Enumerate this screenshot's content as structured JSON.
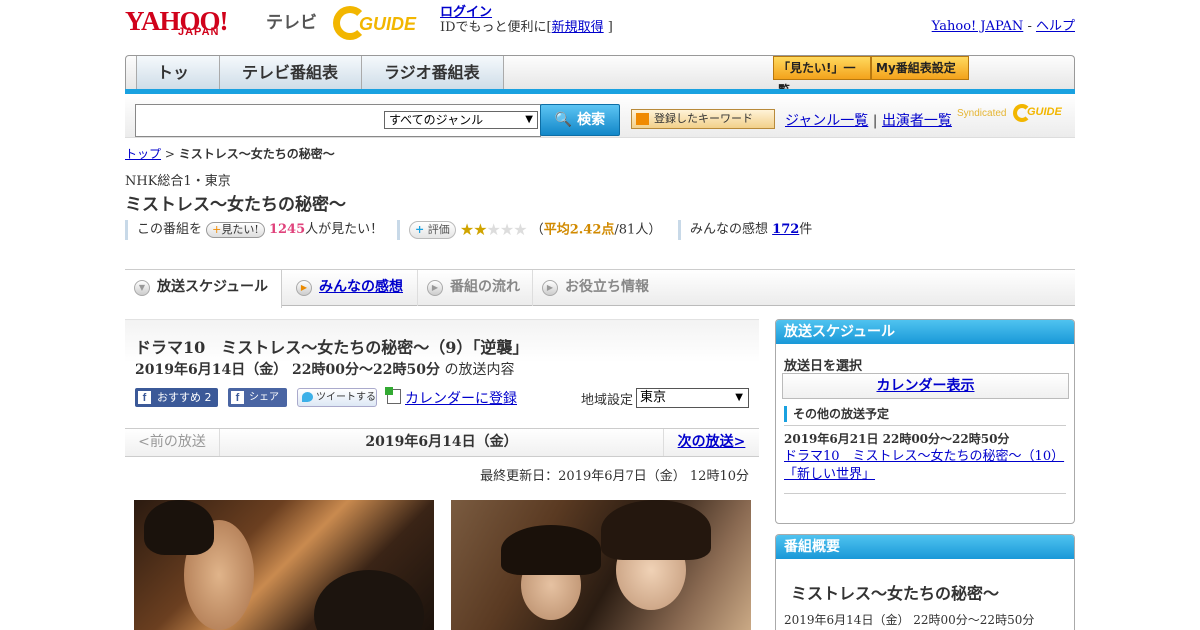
{
  "header": {
    "logo_text": "YAHOO!",
    "logo_sub": "JAPAN",
    "service": "テレビ",
    "partner": "GUIDE",
    "login": "ログイン",
    "login_note": "IDでもっと便利に[",
    "register": "新規取得",
    "login_note_end": "]",
    "yahoo_japan_link": "Yahoo! JAPAN",
    "link_sep": "-",
    "help_link": "ヘルプ"
  },
  "nav": {
    "tabs": [
      "トップ",
      "テレビ番組表",
      "ラジオ番組表"
    ],
    "mita_list": "「見たい!」一覧",
    "my_schedule": "My番組表設定"
  },
  "search": {
    "input_value": "",
    "genre_selected": "すべてのジャンル",
    "search_label": "検索",
    "keyword_label": "登録したキーワード",
    "genre_list": "ジャンル一覧",
    "divider": "|",
    "cast_list": "出演者一覧",
    "syndicated": "Syndicated",
    "syndicated_brand": "GUIDE"
  },
  "breadcrumb": {
    "home": "トップ",
    "sep": ">",
    "current": "ミストレス～女たちの秘密～"
  },
  "program": {
    "channel": "NHK総合1・東京",
    "title": "ミストレス～女たちの秘密～",
    "mita_prefix": "この番組を",
    "mita_btn": "見たい!",
    "mita_count": "1245",
    "mita_suffix": "人が見たい！",
    "rate_btn": "評価",
    "rating": 2,
    "rating_max": 5,
    "avg_open": "（",
    "avg_label": "平均2.42点",
    "avg_count": "/81人）",
    "impressions_label": "みんなの感想",
    "impressions_count": "172",
    "impressions_unit": "件"
  },
  "tabs": [
    {
      "label": "放送スケジュール"
    },
    {
      "label": "みんなの感想"
    },
    {
      "label": "番組の流れ"
    },
    {
      "label": "お役立ち情報"
    }
  ],
  "episode": {
    "title": "ドラマ10　ミストレス～女たちの秘密～（9）「逆襲」",
    "airtime": "2019年6月14日（金） 22時00分～22時50分",
    "airtime_suffix": "の放送内容",
    "fb_recommend": "おすすめ 2",
    "fb_share": "シェア",
    "tweet": "ツイートする",
    "calendar": "カレンダーに登録",
    "region_label": "地域設定",
    "region_value": "東京"
  },
  "pager": {
    "prev": "<前の放送",
    "date": "2019年6月14日（金）",
    "next": "次の放送>"
  },
  "updated": "最終更新日：2019年6月7日（金） 12時10分",
  "sidebar": {
    "schedule_head": "放送スケジュール",
    "pick_date": "放送日を選択",
    "calendar_btn": "カレンダー表示",
    "other_head": "その他の放送予定",
    "other_time": "2019年6月21日 22時00分～22時50分",
    "other_link": "ドラマ10　ミストレス～女たちの秘密～（10）「新しい世界」",
    "summary_head": "番組概要",
    "summary_title": "ミストレス～女たちの秘密～",
    "summary_time": "2019年6月14日（金） 22時00分～22時50分"
  },
  "colors": {
    "accent_blue": "#19a1e0",
    "yahoo_red": "#d0021b",
    "gguide_yellow": "#f2b600",
    "link": "#0000cc",
    "pink": "#e0437c"
  }
}
